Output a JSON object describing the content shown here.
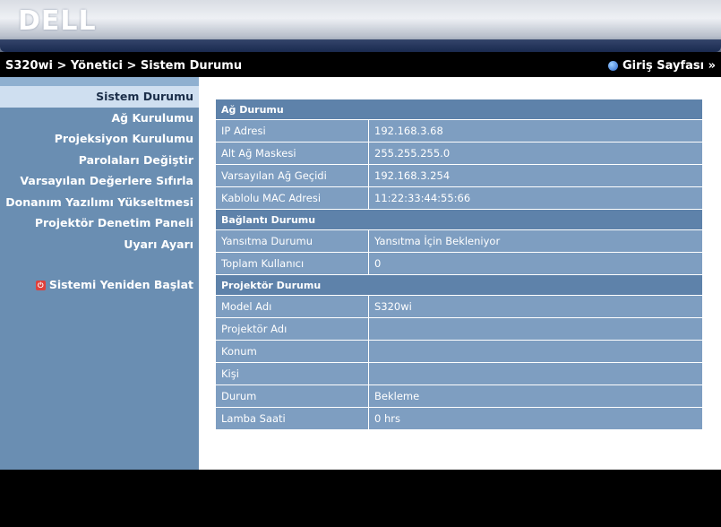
{
  "brand": {
    "logo": "DELL"
  },
  "topbar": {
    "breadcrumb": "S320wi > Yönetici > Sistem Durumu",
    "home_label": "Giriş Sayfası »"
  },
  "sidebar": {
    "items": [
      {
        "label": "Sistem Durumu",
        "active": true
      },
      {
        "label": "Ağ Kurulumu"
      },
      {
        "label": "Projeksiyon Kurulumu"
      },
      {
        "label": "Parolaları Değiştir"
      },
      {
        "label": "Varsayılan Değerlere Sıfırla"
      },
      {
        "label": "Donanım Yazılımı Yükseltmesi"
      },
      {
        "label": "Projektör Denetim Paneli"
      },
      {
        "label": "Uyarı Ayarı"
      }
    ],
    "restart_label": "Sistemi Yeniden Başlat"
  },
  "status": {
    "network": {
      "title": "Ağ Durumu",
      "ip_label": "IP Adresi",
      "ip": "192.168.3.68",
      "mask_label": "Alt Ağ Maskesi",
      "mask": "255.255.255.0",
      "gateway_label": "Varsayılan Ağ Geçidi",
      "gateway": "192.168.3.254",
      "mac_label": "Kablolu MAC Adresi",
      "mac": "11:22:33:44:55:66"
    },
    "connection": {
      "title": "Bağlantı Durumu",
      "mirror_label": "Yansıtma Durumu",
      "mirror": "Yansıtma İçin Bekleniyor",
      "users_label": "Toplam Kullanıcı",
      "users": "0"
    },
    "projector": {
      "title": "Projektör Durumu",
      "model_label": "Model Adı",
      "model": "S320wi",
      "name_label": "Projektör Adı",
      "name": "",
      "location_label": "Konum",
      "location": "",
      "contact_label": "Kişi",
      "contact": "",
      "state_label": "Durum",
      "state": "Bekleme",
      "lamp_label": "Lamba Saati",
      "lamp": "0 hrs"
    }
  }
}
